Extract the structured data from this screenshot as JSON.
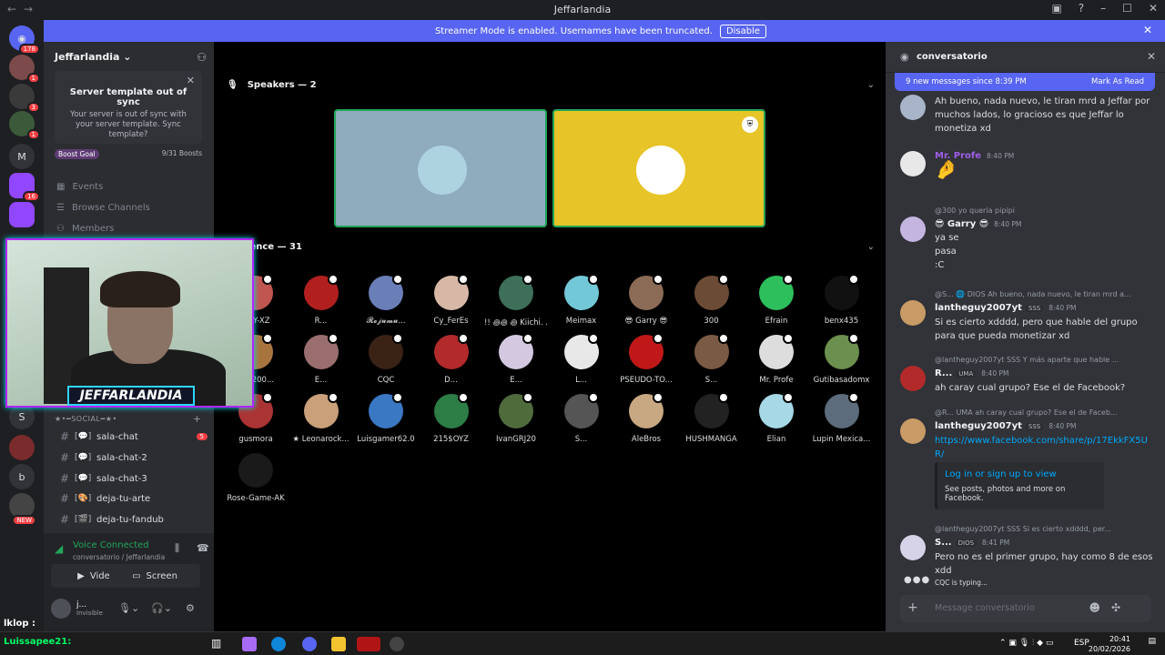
{
  "window": {
    "title": "Jeffarlandia"
  },
  "banner": {
    "text": "Streamer Mode is enabled. Usernames have been truncated.",
    "button": "Disable"
  },
  "guilds": [
    {
      "label": "",
      "badge": "178"
    },
    {
      "label": "",
      "badge": "1"
    },
    {
      "label": "",
      "badge": "3"
    },
    {
      "label": "",
      "badge": "1"
    },
    {
      "label": "M",
      "badge": ""
    },
    {
      "label": "",
      "badge": "16"
    },
    {
      "label": "",
      "badge": ""
    },
    {
      "label": "S",
      "badge": ""
    },
    {
      "label": "",
      "badge": ""
    },
    {
      "label": "b",
      "badge": ""
    },
    {
      "label": "",
      "badge": "NEW"
    }
  ],
  "server": {
    "name": "Jeffarlandia",
    "tooltip_title": "Server template out of sync",
    "tooltip_body": "Your server is out of sync with your server template. Sync template?",
    "boost_goal": "Boost Goal",
    "boost_count": "9/31 Boosts"
  },
  "menu": [
    {
      "label": "Events"
    },
    {
      "label": "Browse Channels"
    },
    {
      "label": "Members"
    }
  ],
  "category": "★•━SOCIAL━★•",
  "channels": [
    {
      "emoji": "[💬]",
      "name": "sala-chat",
      "badge": "5"
    },
    {
      "emoji": "[💬]",
      "name": "sala-chat-2",
      "badge": ""
    },
    {
      "emoji": "[💬]",
      "name": "sala-chat-3",
      "badge": ""
    },
    {
      "emoji": "[🎨]",
      "name": "deja-tu-arte",
      "badge": ""
    },
    {
      "emoji": "[🎬]",
      "name": "deja-tu-fandub",
      "badge": ""
    }
  ],
  "voice": {
    "status": "Voice Connected",
    "sub": "conversatorio / Jeffarlandia",
    "video": "Video",
    "screen": "Screen"
  },
  "user": {
    "name": "j...",
    "status": "Invisible"
  },
  "stage": {
    "speakers": "Speakers — 2",
    "audience": "Audience — 31"
  },
  "audience": [
    "DDY-XZ",
    "R...",
    "𝓡𝓮𝓳𝓾𝓶𝓾...",
    "Cy_FerEs",
    "!! ꩜꩜ ꩜ Kiichi. . .",
    "Meimax",
    "😎 Garry 😎",
    "300",
    "Efrain",
    "benx435",
    "guy200...",
    "E...",
    "CQC",
    "D...",
    "E...",
    "L...",
    "PSEUDO-TO...",
    "S...",
    "Mr. Profe",
    "Gutibasadomx",
    "gusmora",
    "★ Leonarock...",
    "Luisgamer62.0",
    "215$OYZ",
    "IvanGRJ20",
    "S...",
    "AleBros",
    "HUSHMANGA",
    "Elian",
    "Lupin Mexica...",
    "Rose-Game-AK"
  ],
  "colors": {
    "accent": "#5865f2",
    "speaker1": "#8fabbe",
    "speaker2": "#e7c427",
    "online": "#23a559",
    "danger": "#f23f43"
  },
  "webcam": {
    "overlay": "JEFFARLANDIA"
  },
  "thread": {
    "title": "conversatorio",
    "new_messages": "9 new messages since 8:39 PM",
    "mark_read": "Mark As Read"
  },
  "messages": [
    {
      "reply": "",
      "author": "",
      "tag": "",
      "time": "",
      "text": "Ah bueno, nada nuevo, le tiran mrd a Jeffar por muchos lados, lo gracioso es que Jeffar lo monetiza xd"
    },
    {
      "reply": "",
      "author": "Mr. Profe",
      "tag": "",
      "time": "8:40 PM",
      "text": ""
    },
    {
      "reply": "@300 yo queria pipipi",
      "author": "😎 Garry 😎",
      "tag": "",
      "time": "8:40 PM",
      "text": "ya se",
      "text2": "pasa",
      "text3": ":C"
    },
    {
      "reply": "@S... 🌐 DIOS Ah bueno, nada nuevo, le tiran mrd a...",
      "author": "lantheguy2007yt",
      "tag": "SSS",
      "time": "8:40 PM",
      "text": "Si es cierto xdddd, pero que hable del grupo para que pueda monetizar xd"
    },
    {
      "reply": "@lantheguy2007yt SSS Y más aparte que hable ...",
      "author": "R...",
      "tag": "UMA",
      "time": "8:40 PM",
      "text": "ah caray cual grupo? Ese el de Facebook?"
    },
    {
      "reply": "@R... UMA ah caray cual grupo? Ese el de Faceb...",
      "author": "lantheguy2007yt",
      "tag": "SSS",
      "time": "8:40 PM",
      "text": "https://www.facebook.com/share/p/17EkkFX5UR/"
    },
    {
      "reply": "@lantheguy2007yt SSS Si es cierto xdddd, per...",
      "author": "S...",
      "tag": "DIOS",
      "time": "8:41 PM",
      "text": "Pero no es el primer grupo, hay como 8 de esos xdd"
    }
  ],
  "embed": {
    "title": "Log in or sign up to view",
    "desc": "See posts, photos and more on Facebook."
  },
  "typing": "CQC is typing...",
  "composer": {
    "placeholder": "Message conversatorio"
  },
  "taskbar": {
    "time": "20:41",
    "date": "20/02/2026",
    "lang": "ESP"
  },
  "overlay": {
    "line1": "lklop :",
    "line2": "Luissapee21:"
  }
}
